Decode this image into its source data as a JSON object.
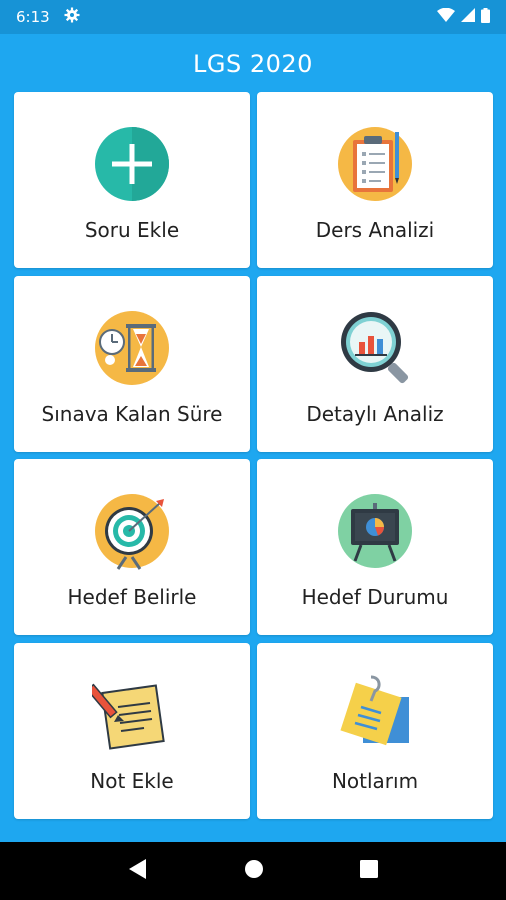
{
  "status": {
    "time": "6:13"
  },
  "app": {
    "title": "LGS 2020"
  },
  "cards": [
    {
      "label": "Soru Ekle",
      "icon": "add-circle-icon"
    },
    {
      "label": "Ders Analizi",
      "icon": "clipboard-icon"
    },
    {
      "label": "Sınava Kalan Süre",
      "icon": "hourglass-icon"
    },
    {
      "label": "Detaylı Analiz",
      "icon": "magnifier-chart-icon"
    },
    {
      "label": "Hedef Belirle",
      "icon": "target-icon"
    },
    {
      "label": "Hedef Durumu",
      "icon": "presentation-board-icon"
    },
    {
      "label": "Not Ekle",
      "icon": "note-pencil-icon"
    },
    {
      "label": "Notlarım",
      "icon": "sticky-note-icon"
    }
  ],
  "colors": {
    "background": "#1ea7f0",
    "status_bar": "#1793d6",
    "card": "#ffffff",
    "nav_bar": "#000000"
  }
}
